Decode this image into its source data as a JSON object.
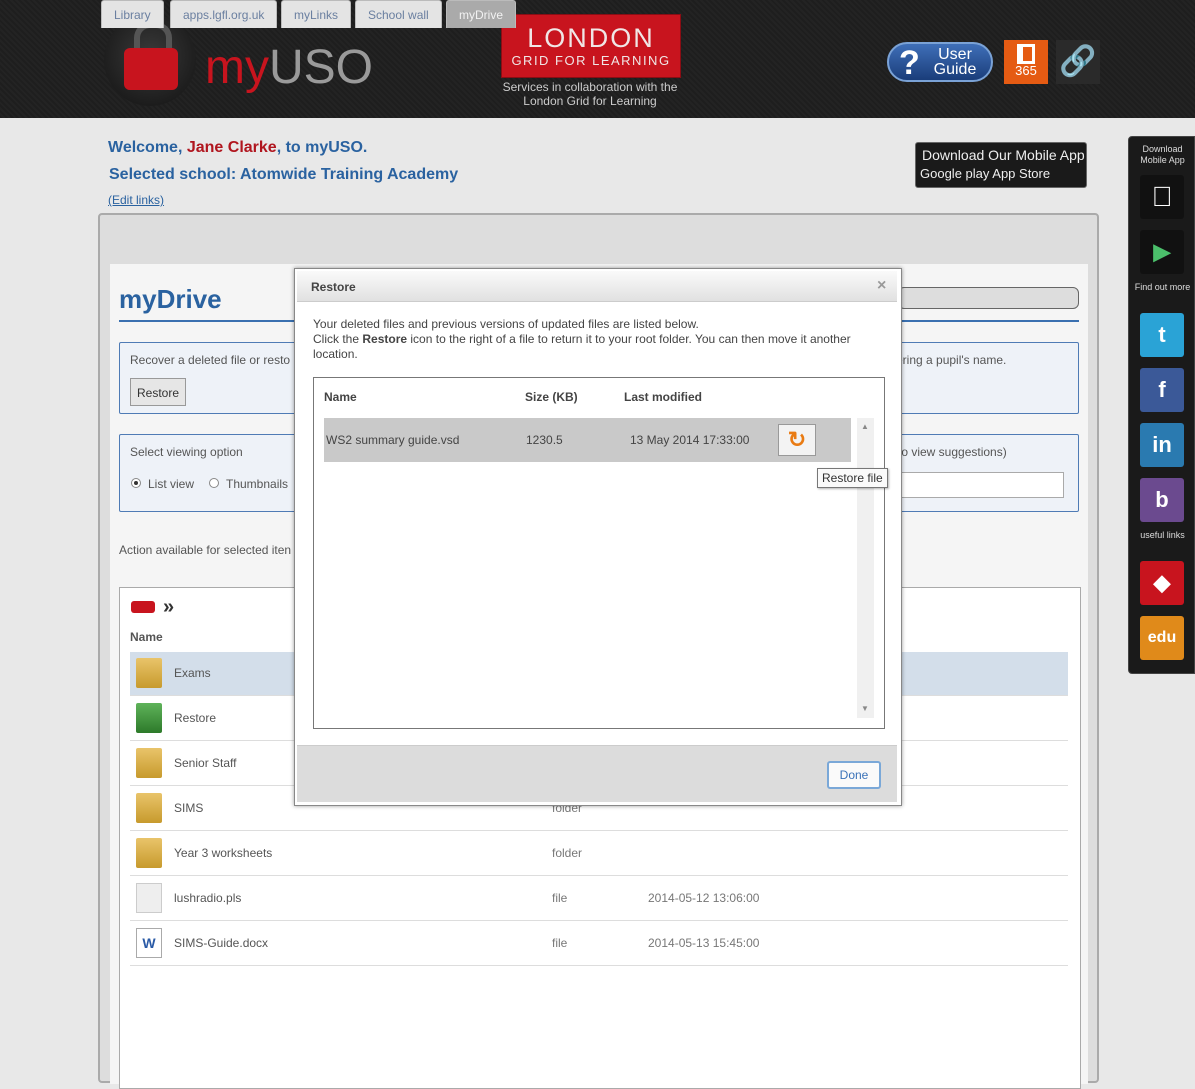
{
  "header": {
    "logo_my": "my",
    "logo_uso": "USO",
    "lgfl_line1": "LONDON",
    "lgfl_line2": "GRID FOR LEARNING",
    "lgfl_sub": "Services in collaboration with the London Grid for Learning",
    "user_guide": "User Guide",
    "o365_label": "365"
  },
  "welcome": {
    "prefix": "Welcome, ",
    "name": "Jane Clarke",
    "suffix": ", to myUSO.",
    "school": "Selected school: Atomwide Training Academy",
    "edit_links": "(Edit links)"
  },
  "mobile_app": {
    "title": "Download Our Mobile App",
    "stores": "Google play  App Store"
  },
  "tabs": [
    "Library",
    "apps.lgfl.org.uk",
    "myLinks",
    "School wall",
    "myDrive"
  ],
  "main": {
    "title": "myDrive",
    "recover_text": "Recover a deleted file or resto",
    "restore_button": "Restore",
    "pupil_text": "ering a pupil's name.",
    "view_option": "Select viewing option",
    "list_view": "List view",
    "thumbnails": "Thumbnails",
    "suggest_text": "to view suggestions)",
    "action_text": "Action available for selected iten",
    "name_header": "Name",
    "files": [
      {
        "name": "Exams",
        "type": "",
        "date": "",
        "icon": "folder-icon"
      },
      {
        "name": "Restore",
        "type": "",
        "date": "",
        "icon": "green-folder-icon"
      },
      {
        "name": "Senior Staff",
        "type": "",
        "date": "",
        "icon": "shared-folder-icon"
      },
      {
        "name": "SIMS",
        "type": "folder",
        "date": "",
        "icon": "folder-icon"
      },
      {
        "name": "Year 3 worksheets",
        "type": "folder",
        "date": "",
        "icon": "shared-folder-icon"
      },
      {
        "name": "lushradio.pls",
        "type": "file",
        "date": "2014-05-12 13:06:00",
        "icon": "file-icon"
      },
      {
        "name": "SIMS-Guide.docx",
        "type": "file",
        "date": "2014-05-13 15:45:00",
        "icon": "word-doc-icon"
      }
    ]
  },
  "sidebar": {
    "download_label": "Download Mobile App",
    "find_out_label": "Find out more",
    "useful_label": "useful links",
    "edu_label": "edu"
  },
  "dialog": {
    "title": "Restore",
    "intro_line1": "Your deleted files and previous versions of updated files are listed below.",
    "intro_line2_pre": "Click the ",
    "intro_line2_bold": "Restore",
    "intro_line2_post": " icon to the right of a file to return it to your root folder. You can then move it another location.",
    "col_name": "Name",
    "col_size": "Size (KB)",
    "col_modified": "Last modified",
    "rows": [
      {
        "name": "WS2 summary guide.vsd",
        "size": "1230.5",
        "modified": "13 May 2014 17:33:00"
      }
    ],
    "tooltip": "Restore file",
    "done": "Done"
  },
  "colors": {
    "accent_blue": "#2a62a0",
    "brand_red": "#c8141e",
    "restore_orange": "#e97b13"
  }
}
